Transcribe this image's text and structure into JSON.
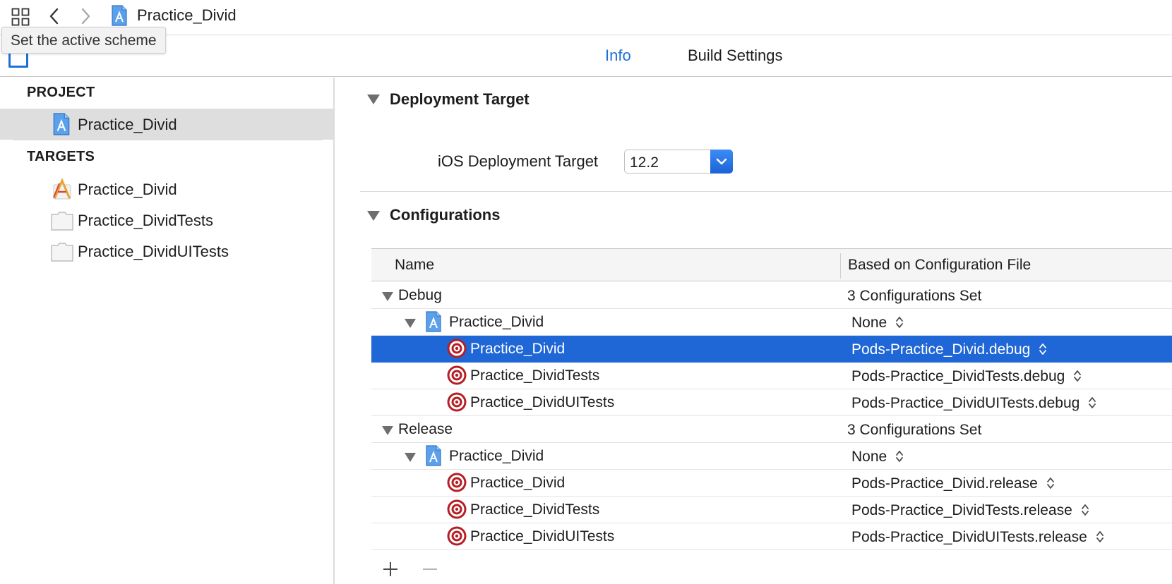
{
  "jumpbar": {
    "title": "Practice_Divid"
  },
  "tooltip": {
    "text": "Set the active scheme"
  },
  "tabs": [
    {
      "label": "Info",
      "active": true
    },
    {
      "label": "Build Settings",
      "active": false
    }
  ],
  "sidebar": {
    "project_header": "PROJECT",
    "project_item": "Practice_Divid",
    "targets_header": "TARGETS",
    "targets": [
      "Practice_Divid",
      "Practice_DividTests",
      "Practice_DividUITests"
    ]
  },
  "deployment": {
    "title": "Deployment Target",
    "field_label": "iOS Deployment Target",
    "field_value": "12.2"
  },
  "configurations": {
    "title": "Configurations",
    "col_name": "Name",
    "col_file": "Based on Configuration File",
    "rows": [
      {
        "name": "Debug",
        "value": "3 Configurations Set"
      },
      {
        "name": "Practice_Divid",
        "value": "None"
      },
      {
        "name": "Practice_Divid",
        "value": "Pods-Practice_Divid.debug"
      },
      {
        "name": "Practice_DividTests",
        "value": "Pods-Practice_DividTests.debug"
      },
      {
        "name": "Practice_DividUITests",
        "value": "Pods-Practice_DividUITests.debug"
      },
      {
        "name": "Release",
        "value": "3 Configurations Set"
      },
      {
        "name": "Practice_Divid",
        "value": "None"
      },
      {
        "name": "Practice_Divid",
        "value": "Pods-Practice_Divid.release"
      },
      {
        "name": "Practice_DividTests",
        "value": "Pods-Practice_DividTests.release"
      },
      {
        "name": "Practice_DividUITests",
        "value": "Pods-Practice_DividUITests.release"
      }
    ]
  },
  "colors": {
    "accent": "#1f6fd9",
    "selection": "#1f66d6",
    "target_red": "#b51f24"
  }
}
